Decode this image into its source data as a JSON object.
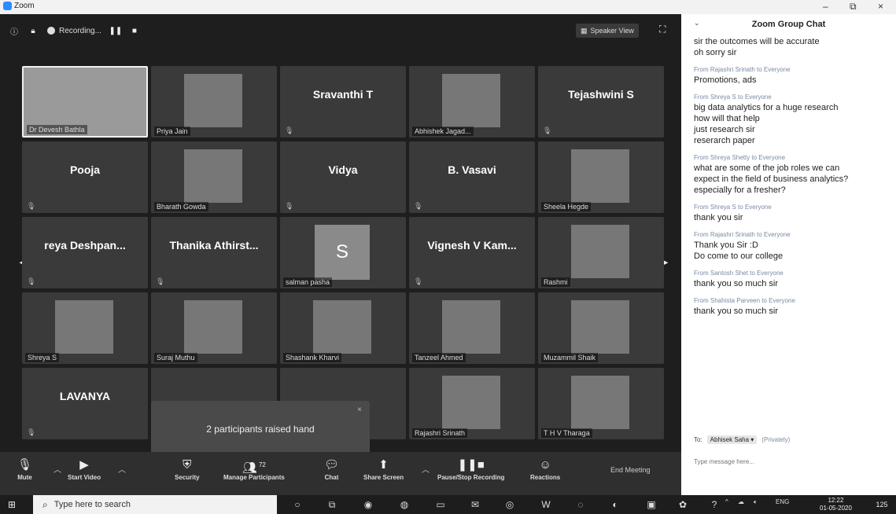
{
  "window": {
    "app_name": "Zoom",
    "controls": [
      "–",
      "⧉",
      "×"
    ]
  },
  "topbar": {
    "recording_label": "Recording...",
    "speaker_view_label": "Speaker View"
  },
  "tiles": [
    {
      "name": "Dr Devesh Bathla",
      "kind": "photo",
      "active": true
    },
    {
      "name": "Priya Jain",
      "kind": "photo"
    },
    {
      "name": "Sravanthi T",
      "kind": "text"
    },
    {
      "name": "Abhishek Jagad...",
      "kind": "photo"
    },
    {
      "name": "Tejashwini S",
      "kind": "text"
    },
    {
      "name": "Pooja",
      "kind": "text"
    },
    {
      "name": "Bharath Gowda",
      "kind": "photo"
    },
    {
      "name": "Vidya",
      "kind": "text"
    },
    {
      "name": "B. Vasavi",
      "kind": "text"
    },
    {
      "name": "Sheela Hegde",
      "kind": "photo"
    },
    {
      "name": "reya Deshpan...",
      "kind": "text"
    },
    {
      "name": "Thanika Athirst...",
      "kind": "text"
    },
    {
      "name": "salman pasha",
      "kind": "avatar",
      "initial": "S"
    },
    {
      "name": "Vignesh V Kam...",
      "kind": "text"
    },
    {
      "name": "Rashmi",
      "kind": "photo"
    },
    {
      "name": "Shreya S",
      "kind": "photo"
    },
    {
      "name": "Suraj Muthu",
      "kind": "photo"
    },
    {
      "name": "Shashank Kharvi",
      "kind": "photo"
    },
    {
      "name": "Tanzeel Ahmed",
      "kind": "photo"
    },
    {
      "name": "Muzammil Shaik",
      "kind": "photo"
    },
    {
      "name": "LAVANYA",
      "kind": "text"
    },
    {
      "name": "",
      "kind": "hidden"
    },
    {
      "name": "",
      "kind": "hidden"
    },
    {
      "name": "Rajashri Srinath",
      "kind": "photo"
    },
    {
      "name": "T H V Tharaga",
      "kind": "photo"
    }
  ],
  "toast": {
    "text": "2 participants raised hand"
  },
  "toolbar": {
    "mute": "Mute",
    "start_video": "Start Video",
    "security": "Security",
    "manage_participants": "Manage Participants",
    "participant_count": "72",
    "chat": "Chat",
    "share_screen": "Share Screen",
    "pause_stop_recording": "Pause/Stop Recording",
    "reactions": "Reactions",
    "end_meeting": "End Meeting"
  },
  "chat": {
    "title": "Zoom Group Chat",
    "messages": [
      {
        "from": "",
        "lines": [
          "sir the outcomes will be accurate",
          "oh sorry sir"
        ]
      },
      {
        "from": "From Rajashri Srinath to Everyone",
        "lines": [
          "Promotions, ads"
        ]
      },
      {
        "from": "From Shreya S to Everyone",
        "lines": [
          "big data analytics for a huge research",
          "how will that help",
          "just research sir",
          "reserarch paper"
        ]
      },
      {
        "from": "From Shreya Shetty to Everyone",
        "lines": [
          "what are some of the job roles we can",
          "expect in the field of business analytics?",
          "especially for a fresher?"
        ]
      },
      {
        "from": "From Shreya S to Everyone",
        "lines": [
          "thank you sir"
        ]
      },
      {
        "from": "From Rajashri Srinath to Everyone",
        "lines": [
          "Thank you Sir :D",
          "Do come to our college"
        ]
      },
      {
        "from": "From Santosh Shet to Everyone",
        "lines": [
          "thank you so much sir"
        ]
      },
      {
        "from": "From Shahista Parveen to Everyone",
        "lines": [
          "thank you so much sir"
        ]
      }
    ],
    "to_label": "To:",
    "to_value": "Abhisek Saha",
    "privately": "(Privately)",
    "input_placeholder": "Type message here..."
  },
  "taskbar": {
    "search_placeholder": "Type here to search",
    "language": "ENG",
    "time": "12:22",
    "date": "01-05-2020",
    "notification_count": "125"
  }
}
